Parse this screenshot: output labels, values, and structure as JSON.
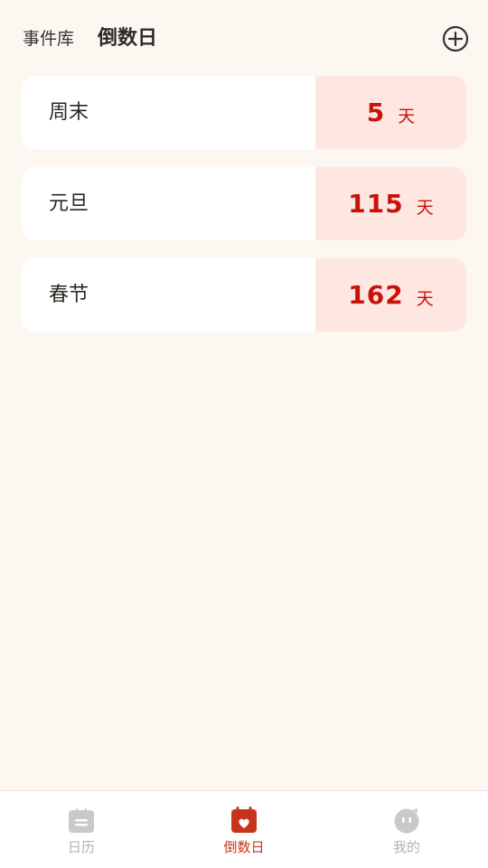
{
  "header": {
    "tab_library": "事件库",
    "tab_countdown": "倒数日",
    "add_icon": "plus-circle-icon"
  },
  "events": [
    {
      "name": "周末",
      "days": "5",
      "unit": "天"
    },
    {
      "name": "元旦",
      "days": "115",
      "unit": "天"
    },
    {
      "name": "春节",
      "days": "162",
      "unit": "天"
    }
  ],
  "bottom_nav": [
    {
      "label": "日历",
      "icon": "calendar-icon",
      "active": false
    },
    {
      "label": "倒数日",
      "icon": "calendar-heart-icon",
      "active": true
    },
    {
      "label": "我的",
      "icon": "profile-face-icon",
      "active": false
    }
  ],
  "colors": {
    "background": "#fdf7f1",
    "accent": "#c8120a",
    "days_box": "#fee7e1",
    "nav_active": "#c8341a",
    "nav_inactive": "#b3b3b3"
  }
}
